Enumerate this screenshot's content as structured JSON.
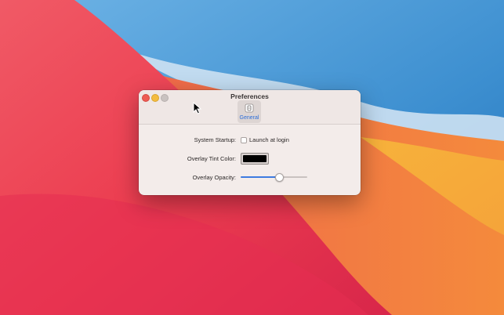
{
  "window": {
    "title": "Preferences",
    "toolbar": {
      "tabs": [
        {
          "label": "General",
          "icon": "switch-icon",
          "selected": true
        }
      ]
    }
  },
  "settings": {
    "system_startup": {
      "label": "System Startup:",
      "checkbox_label": "Launch at login",
      "checked": false
    },
    "overlay_tint": {
      "label": "Overlay Tint Color:",
      "color": "#000000"
    },
    "overlay_opacity": {
      "label": "Overlay Opacity:",
      "value": 0.57
    }
  },
  "colors": {
    "accent": "#3d7be0",
    "close": "#ee5b53",
    "minimize": "#f4bc3f"
  }
}
